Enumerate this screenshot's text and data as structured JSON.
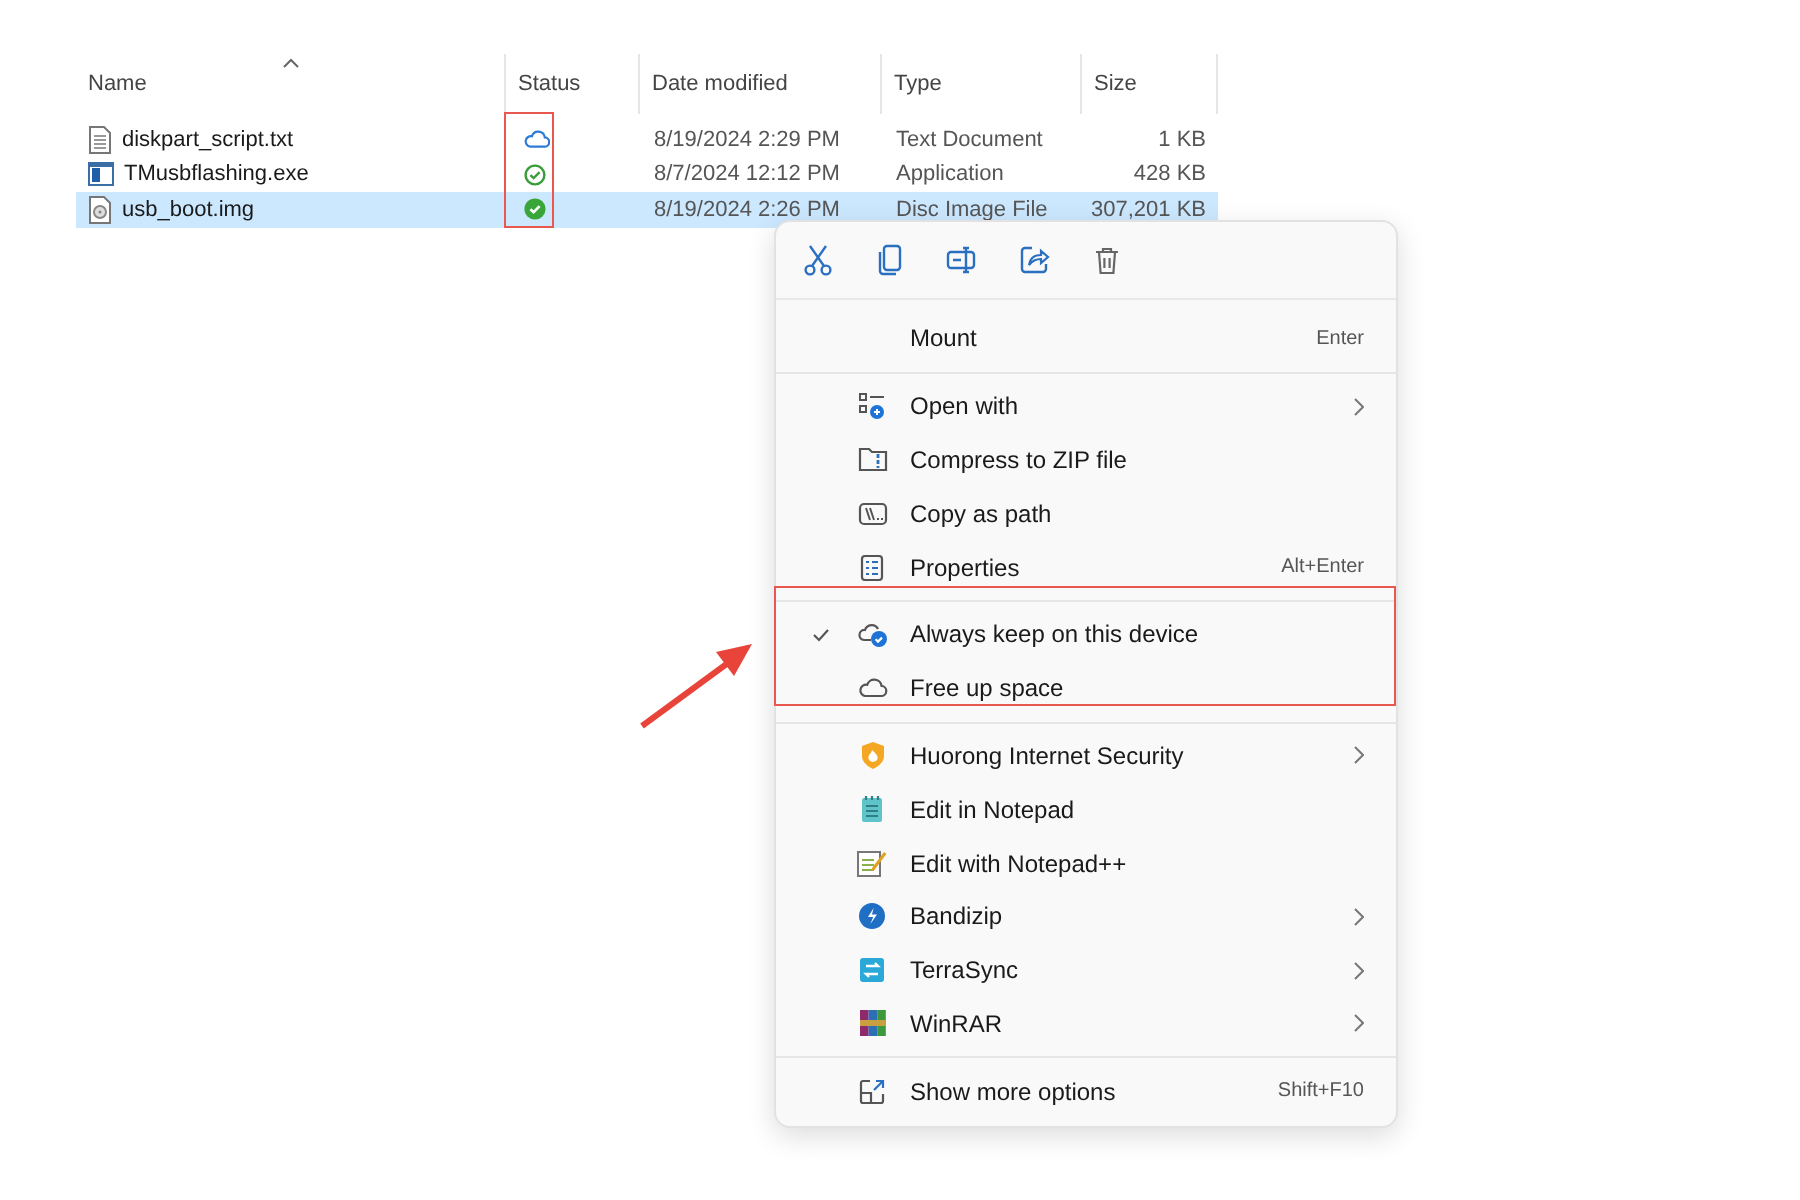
{
  "file_list": {
    "columns": [
      {
        "label": "Name",
        "sorted": true
      },
      {
        "label": "Status",
        "sorted": false
      },
      {
        "label": "Date modified",
        "sorted": false
      },
      {
        "label": "Type",
        "sorted": false
      },
      {
        "label": "Size",
        "sorted": false
      }
    ],
    "rows": [
      {
        "name": "diskpart_script.txt",
        "kind": "text",
        "status": {
          "kind": "cloud"
        },
        "date": "8/19/2024 2:29 PM",
        "type": "Text Document",
        "size": "1 KB",
        "selected": false
      },
      {
        "name": "TMusbflashing.exe",
        "kind": "app",
        "status": {
          "kind": "available"
        },
        "date": "8/7/2024 12:12 PM",
        "type": "Application",
        "size": "428 KB",
        "selected": false
      },
      {
        "name": "usb_boot.img",
        "kind": "disc",
        "status": {
          "kind": "pinned"
        },
        "date": "8/19/2024 2:26 PM",
        "type": "Disc Image File",
        "size": "307,201 KB",
        "selected": true
      }
    ]
  },
  "context_menu": {
    "toolbar": [
      {
        "kind": "cut"
      },
      {
        "kind": "copy"
      },
      {
        "kind": "rename"
      },
      {
        "kind": "share"
      },
      {
        "kind": "delete"
      }
    ],
    "sections": [
      [
        {
          "label": "Mount",
          "shortcut": "Enter",
          "submenu": false,
          "checked": false
        }
      ],
      [
        {
          "label": "Open with",
          "kind": "open-with",
          "submenu": true,
          "checked": false
        },
        {
          "label": "Compress to ZIP file",
          "kind": "zip",
          "submenu": false,
          "checked": false
        },
        {
          "label": "Copy as path",
          "kind": "copy-path",
          "submenu": false,
          "checked": false
        },
        {
          "label": "Properties",
          "kind": "properties",
          "shortcut": "Alt+Enter",
          "submenu": false,
          "checked": false
        }
      ],
      [
        {
          "label": "Always keep on this device",
          "kind": "cloud-keep",
          "submenu": false,
          "checked": true
        },
        {
          "label": "Free up space",
          "kind": "cloud",
          "submenu": false,
          "checked": false
        }
      ],
      [
        {
          "label": "Huorong Internet Security",
          "kind": "huorong",
          "submenu": true,
          "checked": false
        },
        {
          "label": "Edit in Notepad",
          "kind": "notepad",
          "submenu": false,
          "checked": false
        },
        {
          "label": "Edit with Notepad++",
          "kind": "notepad-plus",
          "submenu": false,
          "checked": false
        },
        {
          "label": "Bandizip",
          "kind": "bandizip",
          "submenu": true,
          "checked": false
        },
        {
          "label": "TerraSync",
          "kind": "terrasync",
          "submenu": true,
          "checked": false
        },
        {
          "label": "WinRAR",
          "kind": "winrar",
          "submenu": true,
          "checked": false
        }
      ],
      [
        {
          "label": "Show more options",
          "kind": "more-options",
          "shortcut": "Shift+F10",
          "submenu": false,
          "checked": false
        }
      ]
    ]
  }
}
